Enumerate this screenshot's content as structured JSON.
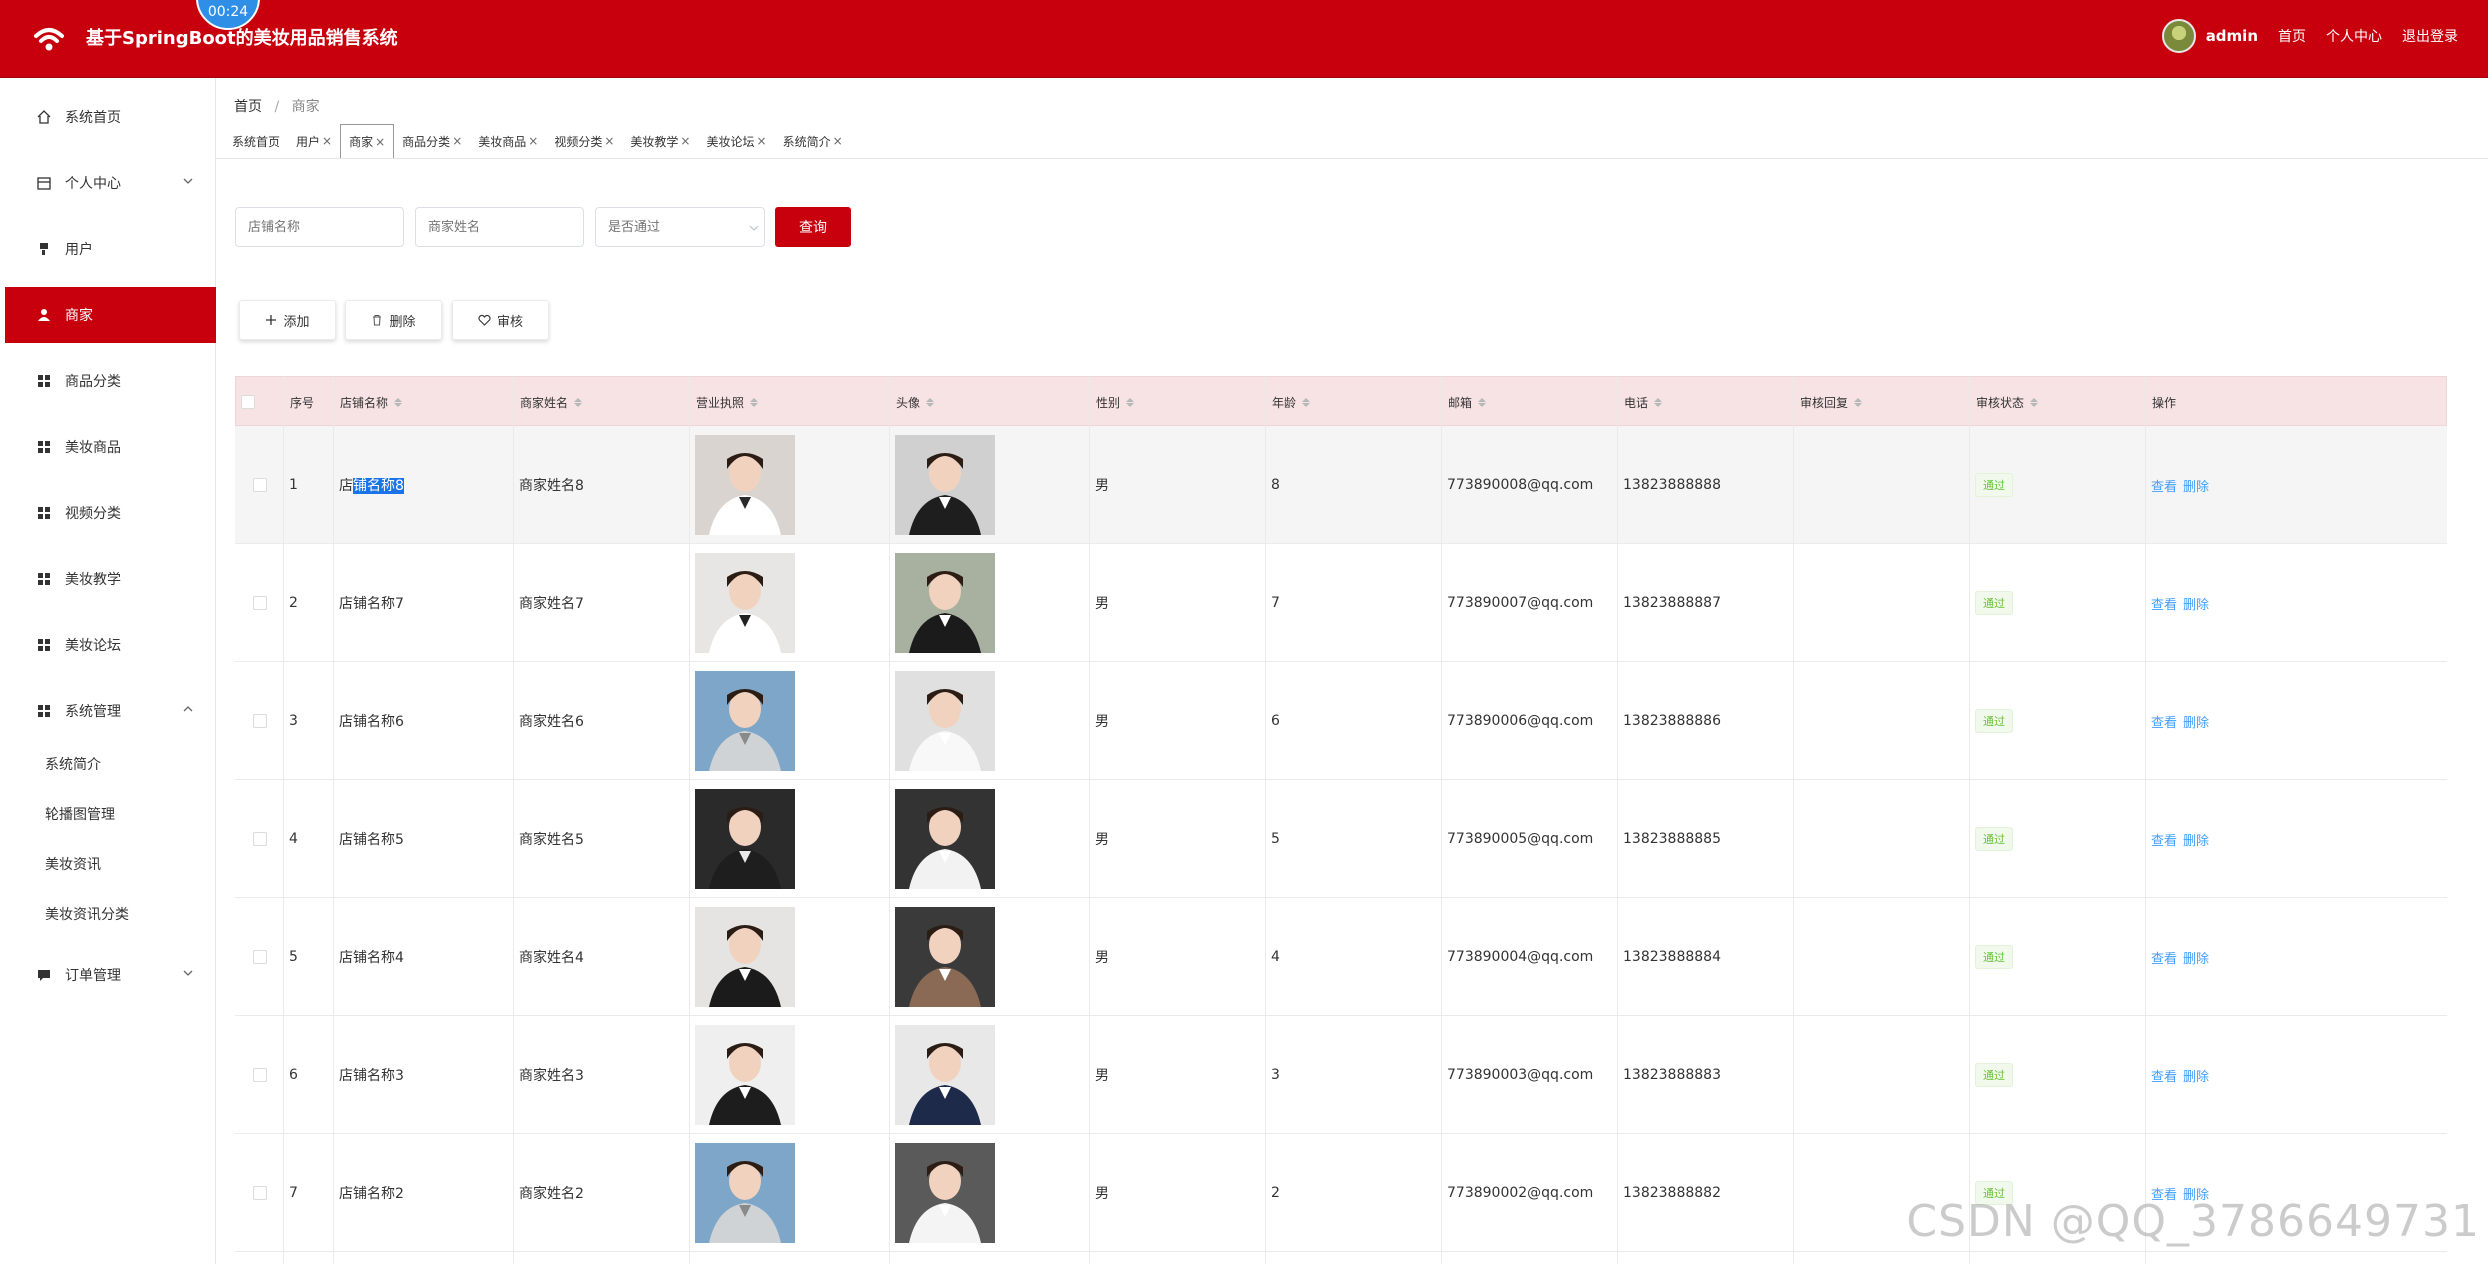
{
  "header": {
    "title": "基于SpringBoot的美妆用品销售系统",
    "timer": "00:24",
    "user": "admin",
    "links": [
      "首页",
      "个人中心",
      "退出登录"
    ]
  },
  "sidebar": {
    "items": [
      {
        "label": "系统首页",
        "icon": "home-icon"
      },
      {
        "label": "个人中心",
        "icon": "calendar-icon",
        "chevron": "down"
      },
      {
        "label": "用户",
        "icon": "user-pin-icon"
      },
      {
        "label": "商家",
        "icon": "person-icon",
        "active": true
      },
      {
        "label": "商品分类",
        "icon": "grid-icon"
      },
      {
        "label": "美妆商品",
        "icon": "grid-icon"
      },
      {
        "label": "视频分类",
        "icon": "grid-icon"
      },
      {
        "label": "美妆教学",
        "icon": "grid-icon"
      },
      {
        "label": "美妆论坛",
        "icon": "grid-icon"
      },
      {
        "label": "系统管理",
        "icon": "grid-icon",
        "chevron": "up"
      }
    ],
    "sub_items": [
      "系统简介",
      "轮播图管理",
      "美妆资讯",
      "美妆资讯分类"
    ],
    "last_item": {
      "label": "订单管理",
      "icon": "message-icon",
      "chevron": "down"
    }
  },
  "breadcrumb": {
    "home": "首页",
    "sep": "/",
    "current": "商家"
  },
  "tabs": [
    {
      "label": "系统首页",
      "closable": false
    },
    {
      "label": "用户",
      "closable": true
    },
    {
      "label": "商家",
      "closable": true,
      "active": true
    },
    {
      "label": "商品分类",
      "closable": true
    },
    {
      "label": "美妆商品",
      "closable": true
    },
    {
      "label": "视频分类",
      "closable": true
    },
    {
      "label": "美妆教学",
      "closable": true
    },
    {
      "label": "美妆论坛",
      "closable": true
    },
    {
      "label": "系统简介",
      "closable": true
    }
  ],
  "search": {
    "shop_placeholder": "店铺名称",
    "merchant_placeholder": "商家姓名",
    "approved_placeholder": "是否通过",
    "query_label": "查询"
  },
  "actions": {
    "add": "添加",
    "delete": "删除",
    "review": "审核"
  },
  "table": {
    "headers": [
      "序号",
      "店铺名称",
      "商家姓名",
      "营业执照",
      "头像",
      "性别",
      "年龄",
      "邮箱",
      "电话",
      "审核回复",
      "审核状态",
      "操作"
    ],
    "rows": [
      {
        "no": "1",
        "shop": "店铺名称8",
        "name": "商家姓名8",
        "gender": "男",
        "age": "8",
        "email": "773890008@qq.com",
        "phone": "13823888888",
        "reply": "",
        "status": "通过"
      },
      {
        "no": "2",
        "shop": "店铺名称7",
        "name": "商家姓名7",
        "gender": "男",
        "age": "7",
        "email": "773890007@qq.com",
        "phone": "13823888887",
        "reply": "",
        "status": "通过"
      },
      {
        "no": "3",
        "shop": "店铺名称6",
        "name": "商家姓名6",
        "gender": "男",
        "age": "6",
        "email": "773890006@qq.com",
        "phone": "13823888886",
        "reply": "",
        "status": "通过"
      },
      {
        "no": "4",
        "shop": "店铺名称5",
        "name": "商家姓名5",
        "gender": "男",
        "age": "5",
        "email": "773890005@qq.com",
        "phone": "13823888885",
        "reply": "",
        "status": "通过"
      },
      {
        "no": "5",
        "shop": "店铺名称4",
        "name": "商家姓名4",
        "gender": "男",
        "age": "4",
        "email": "773890004@qq.com",
        "phone": "13823888884",
        "reply": "",
        "status": "通过"
      },
      {
        "no": "6",
        "shop": "店铺名称3",
        "name": "商家姓名3",
        "gender": "男",
        "age": "3",
        "email": "773890003@qq.com",
        "phone": "13823888883",
        "reply": "",
        "status": "通过"
      },
      {
        "no": "7",
        "shop": "店铺名称2",
        "name": "商家姓名2",
        "gender": "男",
        "age": "2",
        "email": "773890002@qq.com",
        "phone": "13823888882",
        "reply": "",
        "status": "通过"
      }
    ],
    "op_view": "查看",
    "op_delete": "删除"
  },
  "watermark": "CSDN @QQ_3786649731",
  "colors": {
    "brand": "#c8000e",
    "header_row": "#f8e3e4",
    "status_green": "#67c23a",
    "link_blue": "#409eff"
  }
}
